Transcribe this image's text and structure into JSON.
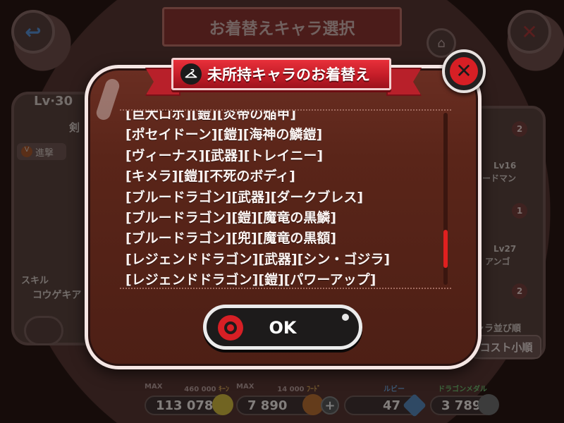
{
  "background": {
    "title": "お着替えキャラ選択",
    "character_level": "Lv·30",
    "character_name_partial": "剣",
    "attack_label": "進撃",
    "skill_label": "スキル",
    "skill_name": "コウゲキア",
    "right_cards": [
      {
        "badge": "2",
        "text": "Lv16",
        "subtext": "ードマン"
      },
      {
        "badge": "1",
        "text": "Lv27",
        "subtext": "アンゴ"
      },
      {
        "badge": "2",
        "text": "",
        "subtext": ""
      }
    ],
    "sort_label": "ャラ並び順",
    "sort_value": "コスト小順"
  },
  "resources": {
    "coin": {
      "max_label": "MAX",
      "max_value": "460 000",
      "unit": "ｷｰﾝ",
      "value": "113 078"
    },
    "food": {
      "max_label": "MAX",
      "max_value": "14 000",
      "unit": "ﾌｰﾄﾞ",
      "value": "7 890"
    },
    "ruby": {
      "label": "ルビー",
      "value": "47"
    },
    "medal": {
      "label": "ドラゴンメダル",
      "value": "3 789"
    }
  },
  "modal": {
    "title": "未所持キャラのお着替え",
    "items": [
      "[巨大ロボ][鎧][炎帝の焔甲]",
      "[ポセイドーン][鎧][海神の鱗鎧]",
      "[ヴィーナス][武器][トレイニー]",
      "[キメラ][鎧][不死のボディ]",
      "[ブルードラゴン][武器][ダークブレス]",
      "[ブルードラゴン][鎧][魔竜の黒鱗]",
      "[ブルードラゴン][兜][魔竜の黒額]",
      "[レジェンドドラゴン][武器][シン・ゴジラ]",
      "[レジェンドドラゴン][鎧][パワーアップ]"
    ],
    "scroll": {
      "thumb_start": 0.68,
      "thumb_length": 0.22
    },
    "ok_label": "OK"
  }
}
